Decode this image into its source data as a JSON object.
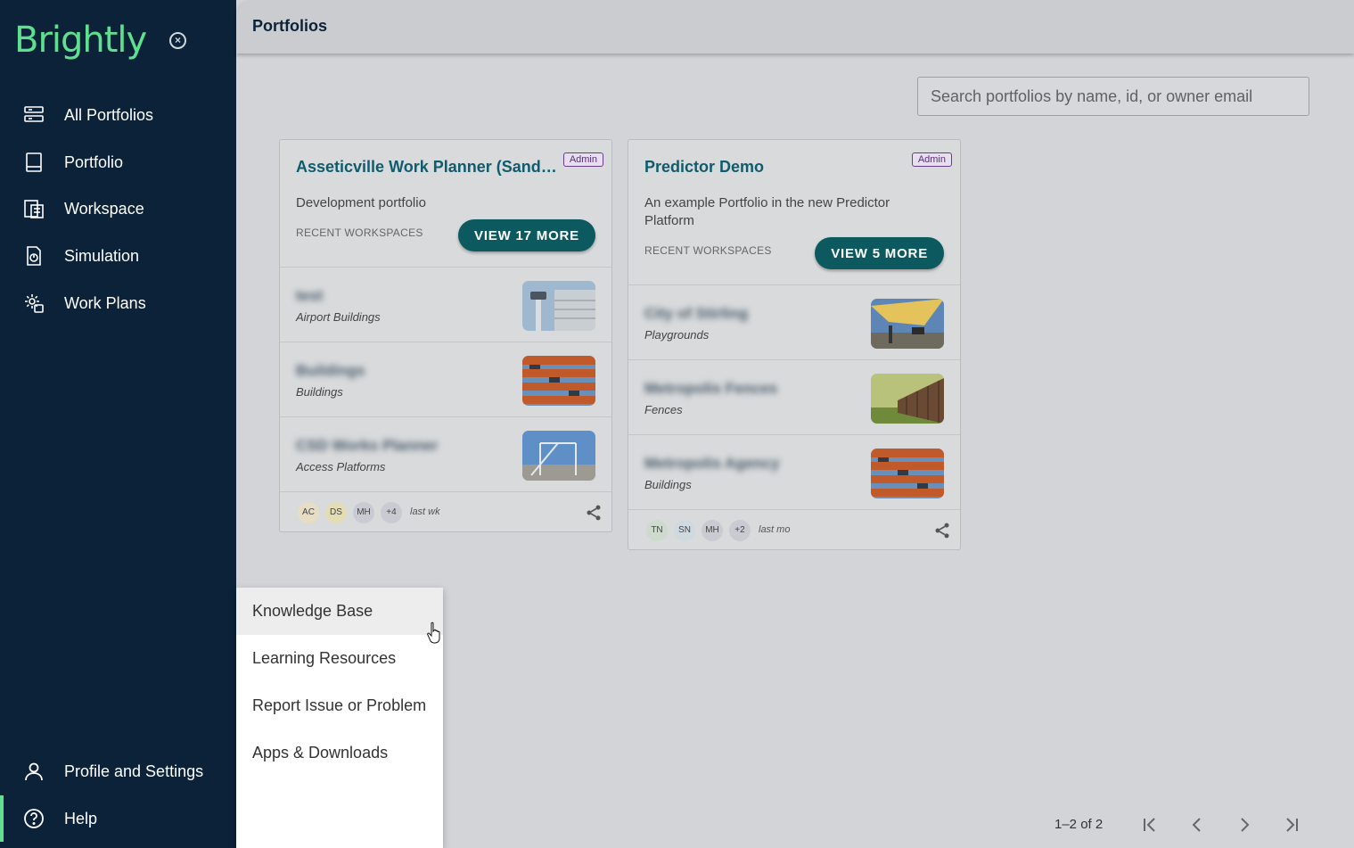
{
  "sidebar": {
    "logo": "Brightly",
    "items": [
      {
        "label": "All Portfolios"
      },
      {
        "label": "Portfolio"
      },
      {
        "label": "Workspace"
      },
      {
        "label": "Simulation"
      },
      {
        "label": "Work Plans"
      }
    ],
    "bottom": [
      {
        "label": "Profile and Settings"
      },
      {
        "label": "Help"
      }
    ]
  },
  "header": {
    "title": "Portfolios"
  },
  "search": {
    "placeholder": "Search portfolios by name, id, or owner email"
  },
  "cards": [
    {
      "title": "Asseticville Work Planner (Sandbox)",
      "badge": "Admin",
      "description": "Development portfolio",
      "recent_label": "RECENT WORKSPACES",
      "view_more": "VIEW 17 MORE",
      "workspaces": [
        {
          "name": "test",
          "type": "Airport Buildings",
          "thumb": "airport-tower"
        },
        {
          "name": "Buildings",
          "type": "Buildings",
          "thumb": "apartment-building"
        },
        {
          "name": "CSD Works Planner",
          "type": "Access Platforms",
          "thumb": "stairs-platform"
        }
      ],
      "avatars": [
        {
          "initials": "AC",
          "color": "#e7dcc4"
        },
        {
          "initials": "DS",
          "color": "#e4dcb3"
        },
        {
          "initials": "MH",
          "color": "#c8ccd2"
        },
        {
          "initials": "+4",
          "color": "#c8ccd2"
        }
      ],
      "last": "last wk"
    },
    {
      "title": "Predictor Demo",
      "badge": "Admin",
      "description": "An example Portfolio in the new Predictor Platform",
      "recent_label": "RECENT WORKSPACES",
      "view_more": "VIEW 5 MORE",
      "workspaces": [
        {
          "name": "City of Stirling",
          "type": "Playgrounds",
          "thumb": "shade-sail"
        },
        {
          "name": "Metropolis Fences",
          "type": "Fences",
          "thumb": "wood-fence"
        },
        {
          "name": "Metropolis Agency",
          "type": "Buildings",
          "thumb": "apartment-building"
        }
      ],
      "avatars": [
        {
          "initials": "TN",
          "color": "#cfdacf"
        },
        {
          "initials": "SN",
          "color": "#cfdae0"
        },
        {
          "initials": "MH",
          "color": "#c8ccd2"
        },
        {
          "initials": "+2",
          "color": "#c8ccd2"
        }
      ],
      "last": "last mo"
    }
  ],
  "help_menu": {
    "items": [
      {
        "label": "Knowledge Base"
      },
      {
        "label": "Learning Resources"
      },
      {
        "label": "Report Issue or Problem"
      },
      {
        "label": "Apps & Downloads"
      }
    ]
  },
  "pagination": {
    "text": "1–2 of 2"
  },
  "colors": {
    "sidebar": "#0b2239",
    "accent": "#5fe08f",
    "button": "#0c5a5f",
    "title": "#0f5c6e"
  }
}
